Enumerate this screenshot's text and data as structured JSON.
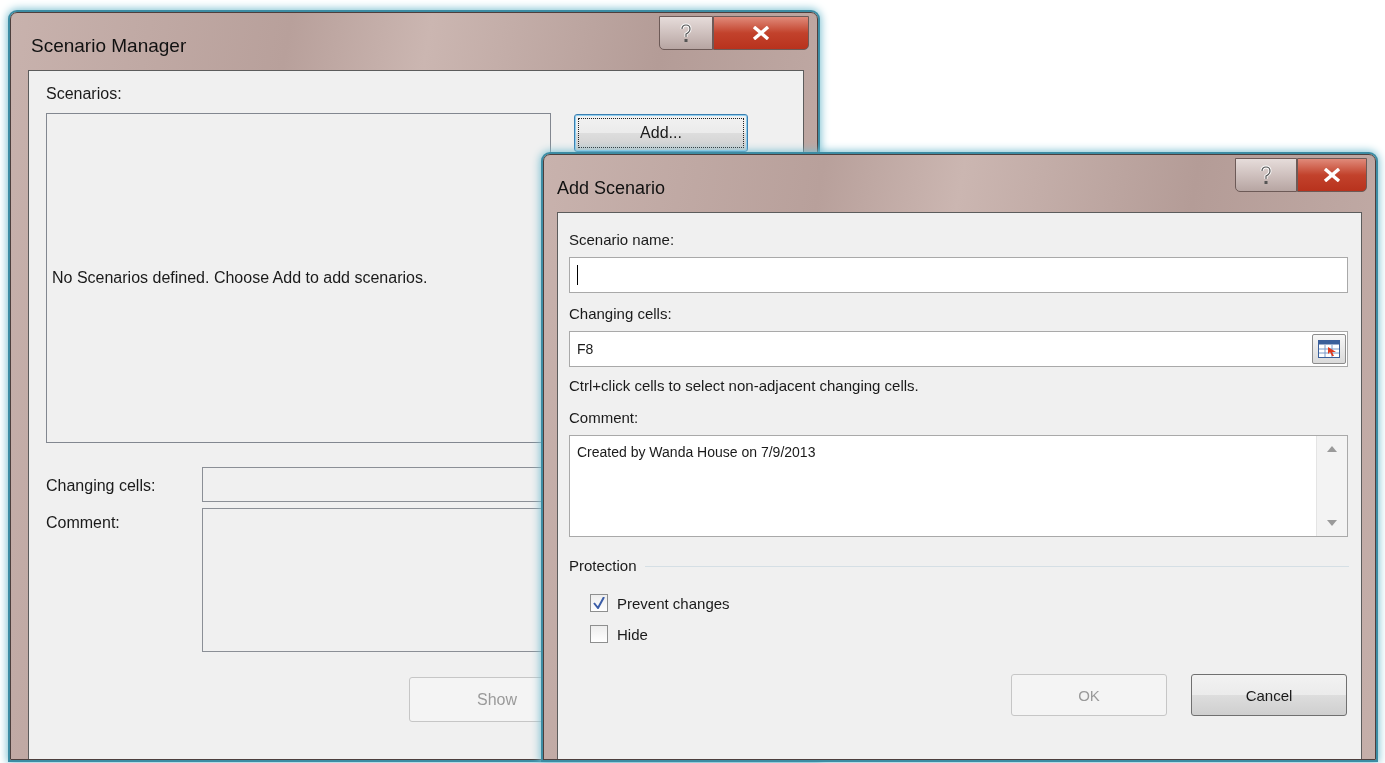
{
  "scenario_manager": {
    "title": "Scenario Manager",
    "scenarios_label": "Scenarios:",
    "empty_message": "No Scenarios defined. Choose Add to add scenarios.",
    "add_button": {
      "label": "Add...",
      "focused": true
    },
    "changing_cells_label": "Changing cells:",
    "comment_label": "Comment:",
    "show_button": {
      "label": "Show",
      "disabled": true
    }
  },
  "add_scenario": {
    "title": "Add Scenario",
    "scenario_name": {
      "label": "Scenario name:",
      "focused": true
    },
    "changing_cells": {
      "label": "Changing cells:",
      "value": "F8"
    },
    "hint": "Ctrl+click cells to select non-adjacent changing cells.",
    "comment": {
      "label": "Comment:",
      "value": "Created by Wanda House on 7/9/2013"
    },
    "protection_label": "Protection",
    "checkboxes": [
      {
        "label": "Prevent changes",
        "checked": true
      },
      {
        "label": "Hide",
        "checked": false
      }
    ],
    "buttons": [
      {
        "label": "OK",
        "disabled": true
      },
      {
        "label": "Cancel",
        "disabled": false
      }
    ]
  }
}
